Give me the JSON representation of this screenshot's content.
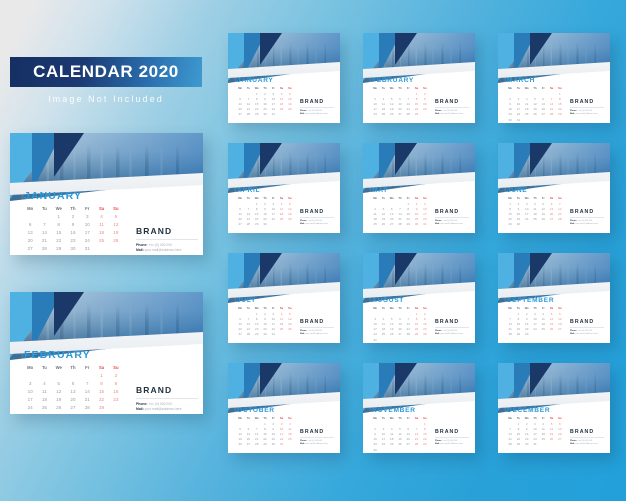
{
  "header": {
    "title": "CALENDAR 2020",
    "subtitle": "Image Not Included"
  },
  "colors": {
    "accent_blue": "#2a9ada",
    "dark_navy": "#1a3868",
    "mid_blue": "#2a7cb8",
    "light_blue": "#4fb0e2",
    "weekend_red": "#e84a4a",
    "background_from": "#e9e9ea",
    "background_to": "#22a0da",
    "banner_from": "#152f62",
    "banner_to": "#3e9ad0"
  },
  "brand": {
    "name": "BRAND",
    "contact": [
      {
        "key": "Phone:",
        "value": "+xx (0) 000 000"
      },
      {
        "key": "Mail:",
        "value": "your.mail@address.here"
      }
    ]
  },
  "calendar": {
    "year": "2020",
    "weekday_headers": [
      "Mo",
      "Tu",
      "We",
      "Th",
      "Fr",
      "Sa",
      "Su"
    ],
    "weekend_indices": [
      5,
      6
    ]
  },
  "featured_cards": [
    {
      "month": "JANUARY",
      "weeks": [
        [
          "",
          "",
          "1",
          "2",
          "3",
          "4",
          "5"
        ],
        [
          "6",
          "7",
          "8",
          "9",
          "10",
          "11",
          "12"
        ],
        [
          "13",
          "14",
          "15",
          "16",
          "17",
          "18",
          "19"
        ],
        [
          "20",
          "21",
          "22",
          "23",
          "24",
          "25",
          "26"
        ],
        [
          "27",
          "28",
          "29",
          "30",
          "31",
          "",
          ""
        ]
      ]
    },
    {
      "month": "FEBRUARY",
      "weeks": [
        [
          "",
          "",
          "",
          "",
          "",
          "1",
          "2"
        ],
        [
          "3",
          "4",
          "5",
          "6",
          "7",
          "8",
          "9"
        ],
        [
          "10",
          "11",
          "12",
          "13",
          "14",
          "15",
          "16"
        ],
        [
          "17",
          "18",
          "19",
          "20",
          "21",
          "22",
          "23"
        ],
        [
          "24",
          "25",
          "26",
          "27",
          "28",
          "29",
          ""
        ]
      ]
    }
  ],
  "months": [
    {
      "month": "JANUARY",
      "weeks": [
        [
          "",
          "",
          "1",
          "2",
          "3",
          "4",
          "5"
        ],
        [
          "6",
          "7",
          "8",
          "9",
          "10",
          "11",
          "12"
        ],
        [
          "13",
          "14",
          "15",
          "16",
          "17",
          "18",
          "19"
        ],
        [
          "20",
          "21",
          "22",
          "23",
          "24",
          "25",
          "26"
        ],
        [
          "27",
          "28",
          "29",
          "30",
          "31",
          "",
          ""
        ]
      ]
    },
    {
      "month": "FEBRUARY",
      "weeks": [
        [
          "",
          "",
          "",
          "",
          "",
          "1",
          "2"
        ],
        [
          "3",
          "4",
          "5",
          "6",
          "7",
          "8",
          "9"
        ],
        [
          "10",
          "11",
          "12",
          "13",
          "14",
          "15",
          "16"
        ],
        [
          "17",
          "18",
          "19",
          "20",
          "21",
          "22",
          "23"
        ],
        [
          "24",
          "25",
          "26",
          "27",
          "28",
          "29",
          ""
        ]
      ]
    },
    {
      "month": "MARCH",
      "weeks": [
        [
          "",
          "",
          "",
          "",
          "",
          "",
          "1"
        ],
        [
          "2",
          "3",
          "4",
          "5",
          "6",
          "7",
          "8"
        ],
        [
          "9",
          "10",
          "11",
          "12",
          "13",
          "14",
          "15"
        ],
        [
          "16",
          "17",
          "18",
          "19",
          "20",
          "21",
          "22"
        ],
        [
          "23",
          "24",
          "25",
          "26",
          "27",
          "28",
          "29"
        ],
        [
          "30",
          "31",
          "",
          "",
          "",
          "",
          ""
        ]
      ]
    },
    {
      "month": "APRIL",
      "weeks": [
        [
          "",
          "",
          "1",
          "2",
          "3",
          "4",
          "5"
        ],
        [
          "6",
          "7",
          "8",
          "9",
          "10",
          "11",
          "12"
        ],
        [
          "13",
          "14",
          "15",
          "16",
          "17",
          "18",
          "19"
        ],
        [
          "20",
          "21",
          "22",
          "23",
          "24",
          "25",
          "26"
        ],
        [
          "27",
          "28",
          "29",
          "30",
          "",
          "",
          ""
        ]
      ]
    },
    {
      "month": "MAY",
      "weeks": [
        [
          "",
          "",
          "",
          "",
          "1",
          "2",
          "3"
        ],
        [
          "4",
          "5",
          "6",
          "7",
          "8",
          "9",
          "10"
        ],
        [
          "11",
          "12",
          "13",
          "14",
          "15",
          "16",
          "17"
        ],
        [
          "18",
          "19",
          "20",
          "21",
          "22",
          "23",
          "24"
        ],
        [
          "25",
          "26",
          "27",
          "28",
          "29",
          "30",
          "31"
        ]
      ]
    },
    {
      "month": "JUNE",
      "weeks": [
        [
          "1",
          "2",
          "3",
          "4",
          "5",
          "6",
          "7"
        ],
        [
          "8",
          "9",
          "10",
          "11",
          "12",
          "13",
          "14"
        ],
        [
          "15",
          "16",
          "17",
          "18",
          "19",
          "20",
          "21"
        ],
        [
          "22",
          "23",
          "24",
          "25",
          "26",
          "27",
          "28"
        ],
        [
          "29",
          "30",
          "",
          "",
          "",
          "",
          ""
        ]
      ]
    },
    {
      "month": "JULY",
      "weeks": [
        [
          "",
          "",
          "1",
          "2",
          "3",
          "4",
          "5"
        ],
        [
          "6",
          "7",
          "8",
          "9",
          "10",
          "11",
          "12"
        ],
        [
          "13",
          "14",
          "15",
          "16",
          "17",
          "18",
          "19"
        ],
        [
          "20",
          "21",
          "22",
          "23",
          "24",
          "25",
          "26"
        ],
        [
          "27",
          "28",
          "29",
          "30",
          "31",
          "",
          ""
        ]
      ]
    },
    {
      "month": "AUGUST",
      "weeks": [
        [
          "",
          "",
          "",
          "",
          "",
          "1",
          "2"
        ],
        [
          "3",
          "4",
          "5",
          "6",
          "7",
          "8",
          "9"
        ],
        [
          "10",
          "11",
          "12",
          "13",
          "14",
          "15",
          "16"
        ],
        [
          "17",
          "18",
          "19",
          "20",
          "21",
          "22",
          "23"
        ],
        [
          "24",
          "25",
          "26",
          "27",
          "28",
          "29",
          "30"
        ],
        [
          "31",
          "",
          "",
          "",
          "",
          "",
          ""
        ]
      ]
    },
    {
      "month": "SEPTEMBER",
      "weeks": [
        [
          "",
          "1",
          "2",
          "3",
          "4",
          "5",
          "6"
        ],
        [
          "7",
          "8",
          "9",
          "10",
          "11",
          "12",
          "13"
        ],
        [
          "14",
          "15",
          "16",
          "17",
          "18",
          "19",
          "20"
        ],
        [
          "21",
          "22",
          "23",
          "24",
          "25",
          "26",
          "27"
        ],
        [
          "28",
          "29",
          "30",
          "",
          "",
          "",
          ""
        ]
      ]
    },
    {
      "month": "OCTOBER",
      "weeks": [
        [
          "",
          "",
          "",
          "1",
          "2",
          "3",
          "4"
        ],
        [
          "5",
          "6",
          "7",
          "8",
          "9",
          "10",
          "11"
        ],
        [
          "12",
          "13",
          "14",
          "15",
          "16",
          "17",
          "18"
        ],
        [
          "19",
          "20",
          "21",
          "22",
          "23",
          "24",
          "25"
        ],
        [
          "26",
          "27",
          "28",
          "29",
          "30",
          "31",
          ""
        ]
      ]
    },
    {
      "month": "NOVEMBER",
      "weeks": [
        [
          "",
          "",
          "",
          "",
          "",
          "",
          "1"
        ],
        [
          "2",
          "3",
          "4",
          "5",
          "6",
          "7",
          "8"
        ],
        [
          "9",
          "10",
          "11",
          "12",
          "13",
          "14",
          "15"
        ],
        [
          "16",
          "17",
          "18",
          "19",
          "20",
          "21",
          "22"
        ],
        [
          "23",
          "24",
          "25",
          "26",
          "27",
          "28",
          "29"
        ],
        [
          "30",
          "",
          "",
          "",
          "",
          "",
          ""
        ]
      ]
    },
    {
      "month": "DECEMBER",
      "weeks": [
        [
          "",
          "1",
          "2",
          "3",
          "4",
          "5",
          "6"
        ],
        [
          "7",
          "8",
          "9",
          "10",
          "11",
          "12",
          "13"
        ],
        [
          "14",
          "15",
          "16",
          "17",
          "18",
          "19",
          "20"
        ],
        [
          "21",
          "22",
          "23",
          "24",
          "25",
          "26",
          "27"
        ],
        [
          "28",
          "29",
          "30",
          "31",
          "",
          "",
          ""
        ]
      ]
    }
  ]
}
